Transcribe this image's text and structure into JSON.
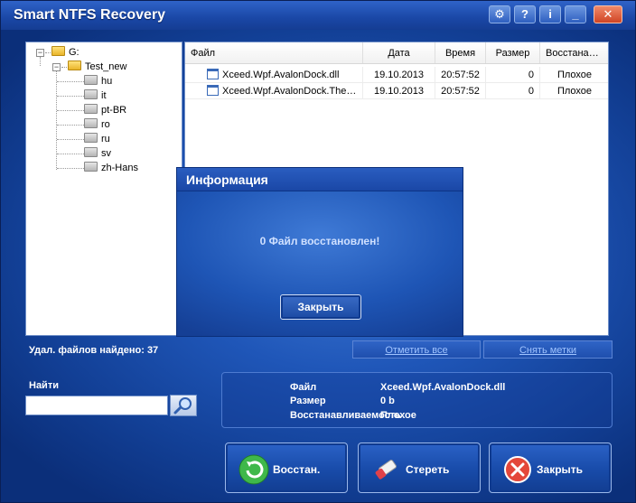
{
  "window": {
    "title": "Smart NTFS Recovery"
  },
  "titlebar_buttons": [
    {
      "name": "settings-icon",
      "glyph": "⚙"
    },
    {
      "name": "help-icon",
      "glyph": "?"
    },
    {
      "name": "info-icon",
      "glyph": "i"
    },
    {
      "name": "minimize-icon",
      "glyph": "_"
    },
    {
      "name": "close-icon",
      "glyph": "✕"
    }
  ],
  "tree": {
    "root": "G:",
    "folder": "Test_new",
    "children": [
      "hu",
      "it",
      "pt-BR",
      "ro",
      "ru",
      "sv",
      "zh-Hans"
    ]
  },
  "list": {
    "columns": [
      "Файл",
      "Дата",
      "Время",
      "Размер",
      "Восстанавливаемость"
    ],
    "rows": [
      {
        "file": "Xceed.Wpf.AvalonDock.dll",
        "date": "19.10.2013",
        "time": "20:57:52",
        "size": "0",
        "status": "Плохое"
      },
      {
        "file": "Xceed.Wpf.AvalonDock.Themes.Aero.dll",
        "date": "19.10.2013",
        "time": "20:57:52",
        "size": "0",
        "status": "Плохое"
      }
    ]
  },
  "found": "Удал. файлов найдено: 37",
  "links": {
    "select_all": "Отметить все",
    "deselect": "Снять метки"
  },
  "search": {
    "label": "Найти",
    "value": "",
    "placeholder": ""
  },
  "info": {
    "file_label": "Файл",
    "file_value": "Xceed.Wpf.AvalonDock.dll",
    "size_label": "Размер",
    "size_value": "0 b",
    "recover_label": "Восстанавливаемость",
    "recover_value": "Плохое"
  },
  "actions": {
    "restore": "Восстан.",
    "erase": "Стереть",
    "close": "Закрыть"
  },
  "modal": {
    "title": "Информация",
    "message": "0 Файл восстановлен!",
    "close": "Закрыть"
  }
}
